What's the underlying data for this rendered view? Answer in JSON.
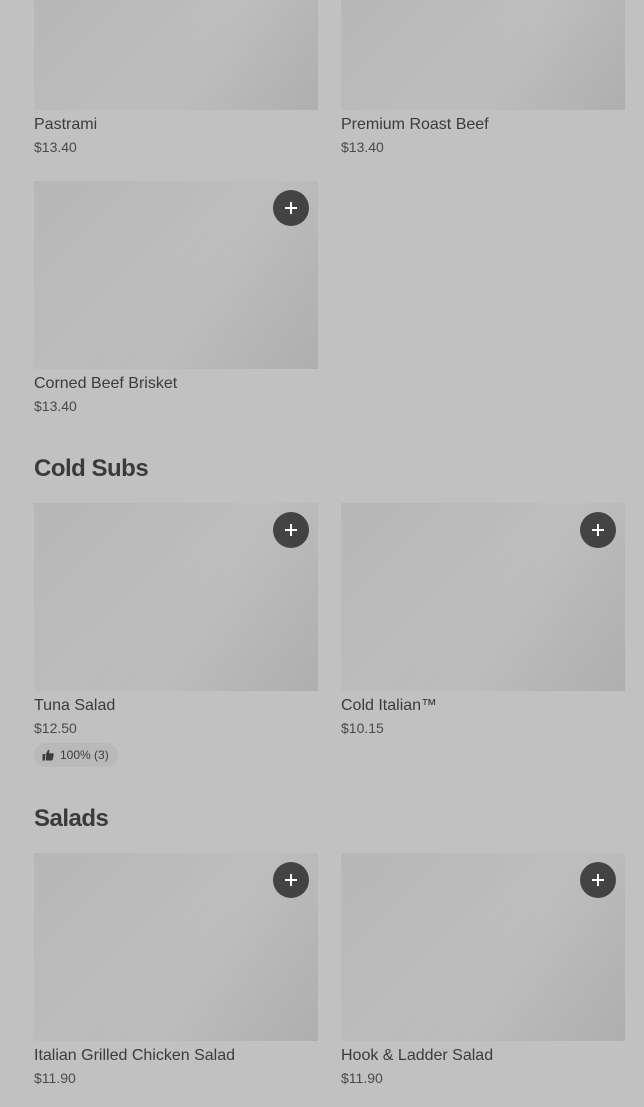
{
  "sections": {
    "top": {
      "items": [
        {
          "name": "Pastrami",
          "price": "$13.40"
        },
        {
          "name": "Premium Roast Beef",
          "price": "$13.40"
        },
        {
          "name": "Corned Beef Brisket",
          "price": "$13.40"
        }
      ]
    },
    "cold_subs": {
      "title": "Cold Subs",
      "items": [
        {
          "name": "Tuna Salad",
          "price": "$12.50",
          "rating": "100% (3)"
        },
        {
          "name": "Cold Italian™",
          "price": "$10.15"
        }
      ]
    },
    "salads": {
      "title": "Salads",
      "items": [
        {
          "name": "Italian Grilled Chicken Salad",
          "price": "$11.90"
        },
        {
          "name": "Hook & Ladder Salad",
          "price": "$11.90"
        }
      ]
    }
  },
  "icons": {
    "add": "plus-icon",
    "rating": "thumbs-up-icon"
  },
  "colors": {
    "background": "#c1c1c1",
    "add_button": "#3e3e3e",
    "text": "#3a3a3a"
  }
}
